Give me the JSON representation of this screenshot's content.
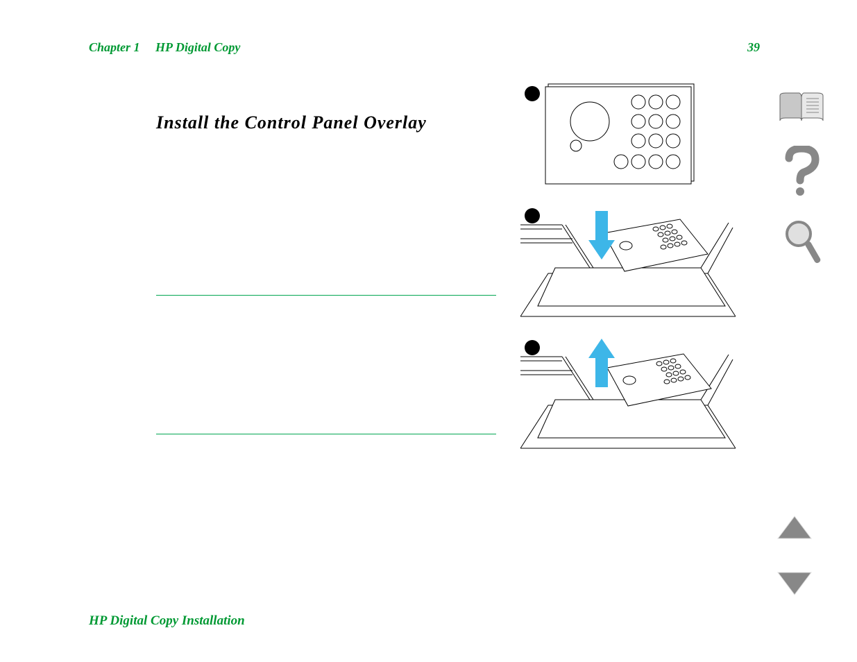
{
  "header": {
    "chapter": "Chapter 1",
    "section": "HP Digital Copy",
    "page": "39"
  },
  "title": "Install the Control Panel Overlay",
  "footer": "HP Digital Copy Installation",
  "icons": {
    "book": "book-icon",
    "help": "help-icon",
    "search": "search-icon",
    "up": "page-up-icon",
    "down": "page-down-icon"
  }
}
